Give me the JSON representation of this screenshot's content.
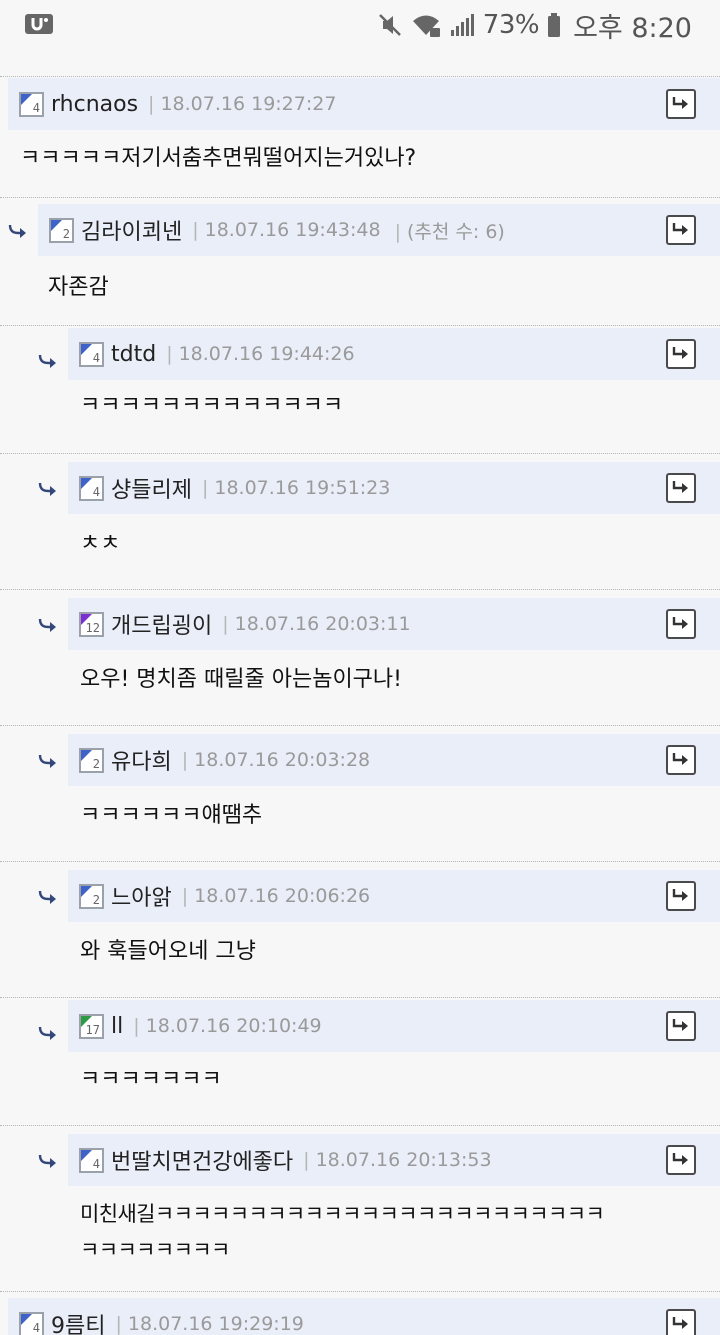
{
  "status": {
    "battery": "73%",
    "time": "오후 8:20"
  },
  "comments": [
    {
      "nick": "rhcnaos",
      "level": "4",
      "date": "18.07.16 19:27:27",
      "text": "ㅋㅋㅋㅋㅋ저기서춤추면뭐떨어지는거있나?",
      "text2": "",
      "rec": ""
    },
    {
      "nick": "김라이쾨넨",
      "level": "2",
      "date": "18.07.16 19:43:48",
      "text": "자존감",
      "text2": "",
      "rec": "(추천 수: 6)"
    },
    {
      "nick": "tdtd",
      "level": "4",
      "date": "18.07.16 19:44:26",
      "text": "ㅋㅋㅋㅋㅋㅋㅋㅋㅋㅋㅋㅋㅋ",
      "text2": "",
      "rec": ""
    },
    {
      "nick": "샹들리제",
      "level": "4",
      "date": "18.07.16 19:51:23",
      "text": "ㅊㅊ",
      "text2": "",
      "rec": ""
    },
    {
      "nick": "개드립굉이",
      "level": "12",
      "date": "18.07.16 20:03:11",
      "text": "오우! 명치좀 때릴줄 아는놈이구나!",
      "text2": "",
      "rec": ""
    },
    {
      "nick": "유다희",
      "level": "2",
      "date": "18.07.16 20:03:28",
      "text": "ㅋㅋㅋㅋㅋㅋ얘땜추",
      "text2": "",
      "rec": ""
    },
    {
      "nick": "느아앍",
      "level": "2",
      "date": "18.07.16 20:06:26",
      "text": "와 훅들어오네 그냥",
      "text2": "",
      "rec": ""
    },
    {
      "nick": "ll",
      "level": "17",
      "date": "18.07.16 20:10:49",
      "text": "ㅋㅋㅋㅋㅋㅋㅋ",
      "text2": "",
      "rec": ""
    },
    {
      "nick": "번딸치면건강에좋다",
      "level": "4",
      "date": "18.07.16 20:13:53",
      "text": "미친새길ㅋㅋㅋㅋㅋㅋㅋㅋㅋㅋㅋㅋㅋㅋㅋㅋㅋㅋㅋㅋㅋㅋㅋㅋ",
      "text2": "ㅋㅋㅋㅋㅋㅋㅋㅋ",
      "rec": ""
    },
    {
      "nick": "9름티",
      "level": "4",
      "date": "18.07.16 19:29:19",
      "text": "",
      "text2": "",
      "rec": ""
    }
  ],
  "colors": {
    "header_bg": "#e9eef9",
    "reply_arrow": "#33477a",
    "level_blue": "#3e62c8",
    "level_purple": "#7b2fd1",
    "level_green": "#2e9a46"
  }
}
